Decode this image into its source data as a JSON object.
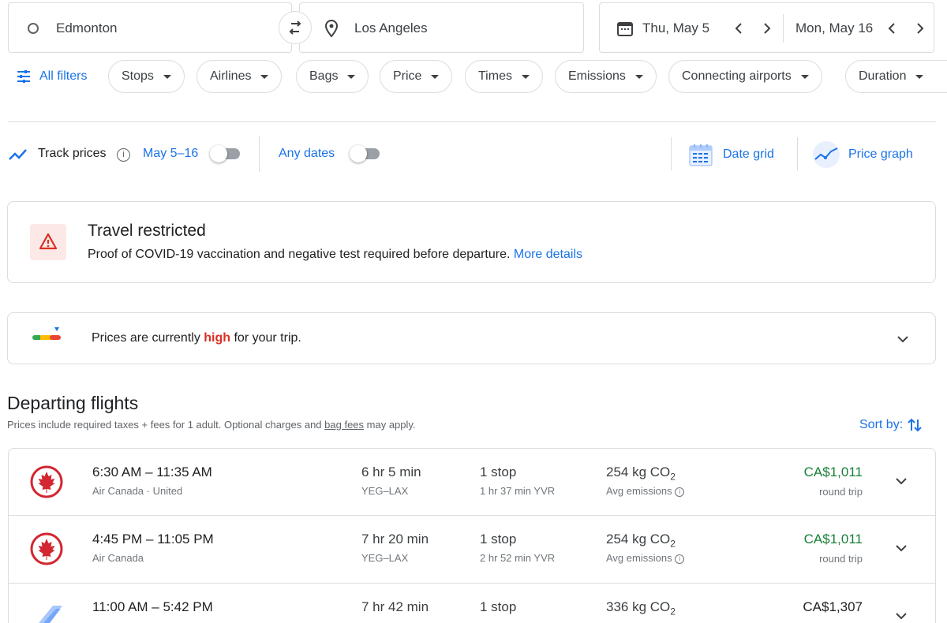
{
  "search": {
    "origin": "Edmonton",
    "destination": "Los Angeles",
    "depart_date": "Thu, May 5",
    "return_date": "Mon, May 16"
  },
  "filters": {
    "all_filters": "All filters",
    "chips": [
      "Stops",
      "Airlines",
      "Bags",
      "Price",
      "Times",
      "Emissions",
      "Connecting airports",
      "Duration"
    ]
  },
  "tracking": {
    "track_prices": "Track prices",
    "date_range": "May 5–16",
    "any_dates": "Any dates",
    "date_grid": "Date grid",
    "price_graph": "Price graph"
  },
  "restriction": {
    "title": "Travel restricted",
    "body": "Proof of COVID-19 vaccination and negative test required before departure.",
    "link": "More details"
  },
  "price_insight": {
    "prefix": "Prices are currently ",
    "level": "high",
    "suffix": " for your trip."
  },
  "results": {
    "heading": "Departing flights",
    "note_prefix": "Prices include required taxes + fees for 1 adult. Optional charges and ",
    "note_link": "bag fees",
    "note_suffix": " may apply.",
    "sort_label": "Sort by:"
  },
  "flights": [
    {
      "time": "6:30 AM – 11:35 AM",
      "airline": "Air Canada · United",
      "duration": "6 hr 5 min",
      "route": "YEG–LAX",
      "stops": "1 stop",
      "layover": "1 hr 37 min YVR",
      "co2": "254 kg CO",
      "co2_sub": "2",
      "emissions": "Avg emissions",
      "price": "CA$1,011",
      "price_type": "round trip",
      "logo": "air-canada-logo"
    },
    {
      "time": "4:45 PM – 11:05 PM",
      "airline": "Air Canada",
      "duration": "7 hr 20 min",
      "route": "YEG–LAX",
      "stops": "1 stop",
      "layover": "2 hr 52 min YVR",
      "co2": "254 kg CO",
      "co2_sub": "2",
      "emissions": "Avg emissions",
      "price": "CA$1,011",
      "price_type": "round trip",
      "logo": "air-canada-logo"
    },
    {
      "time": "11:00 AM – 5:42 PM",
      "airline": "",
      "duration": "7 hr 42 min",
      "route": "",
      "stops": "1 stop",
      "layover": "",
      "co2": "336 kg CO",
      "co2_sub": "2",
      "emissions": "",
      "price": "CA$1,307",
      "price_type": "",
      "logo": "alaska-tail-logo"
    }
  ],
  "colors": {
    "accent": "#1a73e8",
    "good_price": "#188038",
    "high": "#d93025",
    "border": "#dadce0"
  }
}
